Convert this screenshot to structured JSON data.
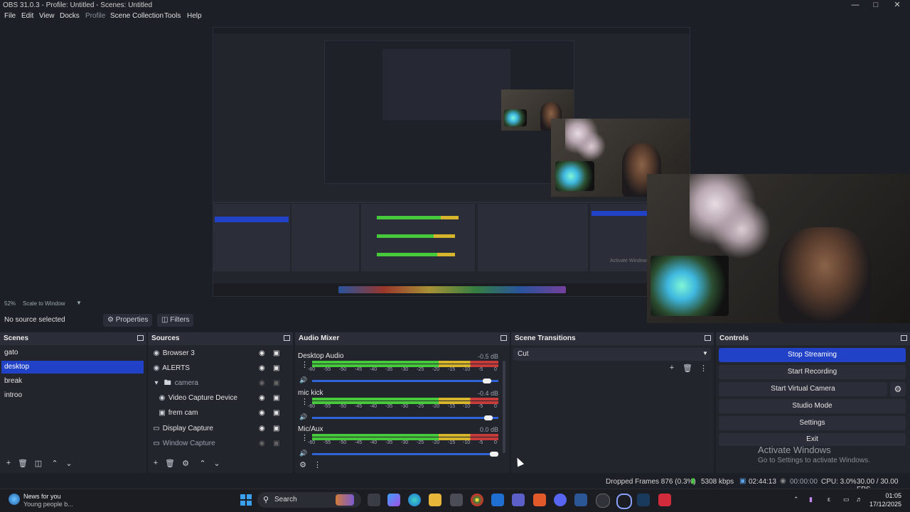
{
  "window": {
    "title": "OBS 31.0.3 - Profile: Untitled - Scenes: Untitled",
    "min_icon": "minimize-icon",
    "max_icon": "maximize-icon",
    "close_icon": "close-icon"
  },
  "menu": [
    "File",
    "Edit",
    "View",
    "Docks",
    "Profile",
    "Scene Collection",
    "Tools",
    "Help"
  ],
  "preview": {
    "zoom_label": "52%",
    "scale_mode": "Scale to Window",
    "nested_watermark_line1": "Activate Windows",
    "nested_watermark_line2": "Go to Settings to activate Windows."
  },
  "source_toolbar": {
    "no_source": "No source selected",
    "properties": "Properties",
    "filters": "Filters"
  },
  "scenes": {
    "title": "Scenes",
    "items": [
      "gato",
      "desktop",
      "break",
      "introo"
    ],
    "selected_index": 1
  },
  "sources": {
    "title": "Sources",
    "items": [
      {
        "label": "Browser 3",
        "icon": "globe-icon"
      },
      {
        "label": "ALERTS",
        "icon": "globe-icon"
      },
      {
        "label": "camera",
        "icon": "folder-icon"
      },
      {
        "label": "Video Capture Device",
        "icon": "camera-icon"
      },
      {
        "label": "frem cam",
        "icon": "image-icon"
      },
      {
        "label": "Display Capture",
        "icon": "monitor-icon"
      },
      {
        "label": "Window Capture",
        "icon": "window-icon"
      }
    ]
  },
  "mixer": {
    "title": "Audio Mixer",
    "scale_ticks": [
      "-60",
      "-55",
      "-50",
      "-45",
      "-40",
      "-35",
      "-30",
      "-25",
      "-20",
      "-15",
      "-10",
      "-5",
      "0"
    ],
    "channels": [
      {
        "name": "Desktop Audio",
        "db": "-0.5 dB",
        "volume": 0.96
      },
      {
        "name": "mic kick",
        "db": "-0.4 dB",
        "volume": 0.97
      },
      {
        "name": "Mic/Aux",
        "db": "0.0 dB",
        "volume": 1.0
      }
    ]
  },
  "transitions": {
    "title": "Scene Transitions",
    "selected": "Cut"
  },
  "controls": {
    "title": "Controls",
    "buttons": [
      "Stop Streaming",
      "Start Recording",
      "Start Virtual Camera",
      "Studio Mode",
      "Settings",
      "Exit"
    ],
    "active_index": 0
  },
  "watermark": {
    "line1": "Activate Windows",
    "line2": "Go to Settings to activate Windows."
  },
  "status": {
    "dropped_frames": "Dropped Frames 876 (0.3%)",
    "bitrate": "5308 kbps",
    "stream_time": "02:44:13",
    "rec_time": "00:00:00",
    "cpu": "CPU: 3.0%",
    "fps": "30.00 / 30.00 FPS"
  },
  "taskbar": {
    "news_title": "News for you",
    "news_sub": "Young people b...",
    "search": "Search",
    "time": "01:05",
    "date": "17/12/2025"
  },
  "colors": {
    "accent": "#2142c7",
    "meter_green": "#46c93a",
    "meter_yellow": "#d6b52d",
    "meter_red": "#c73b3b"
  }
}
